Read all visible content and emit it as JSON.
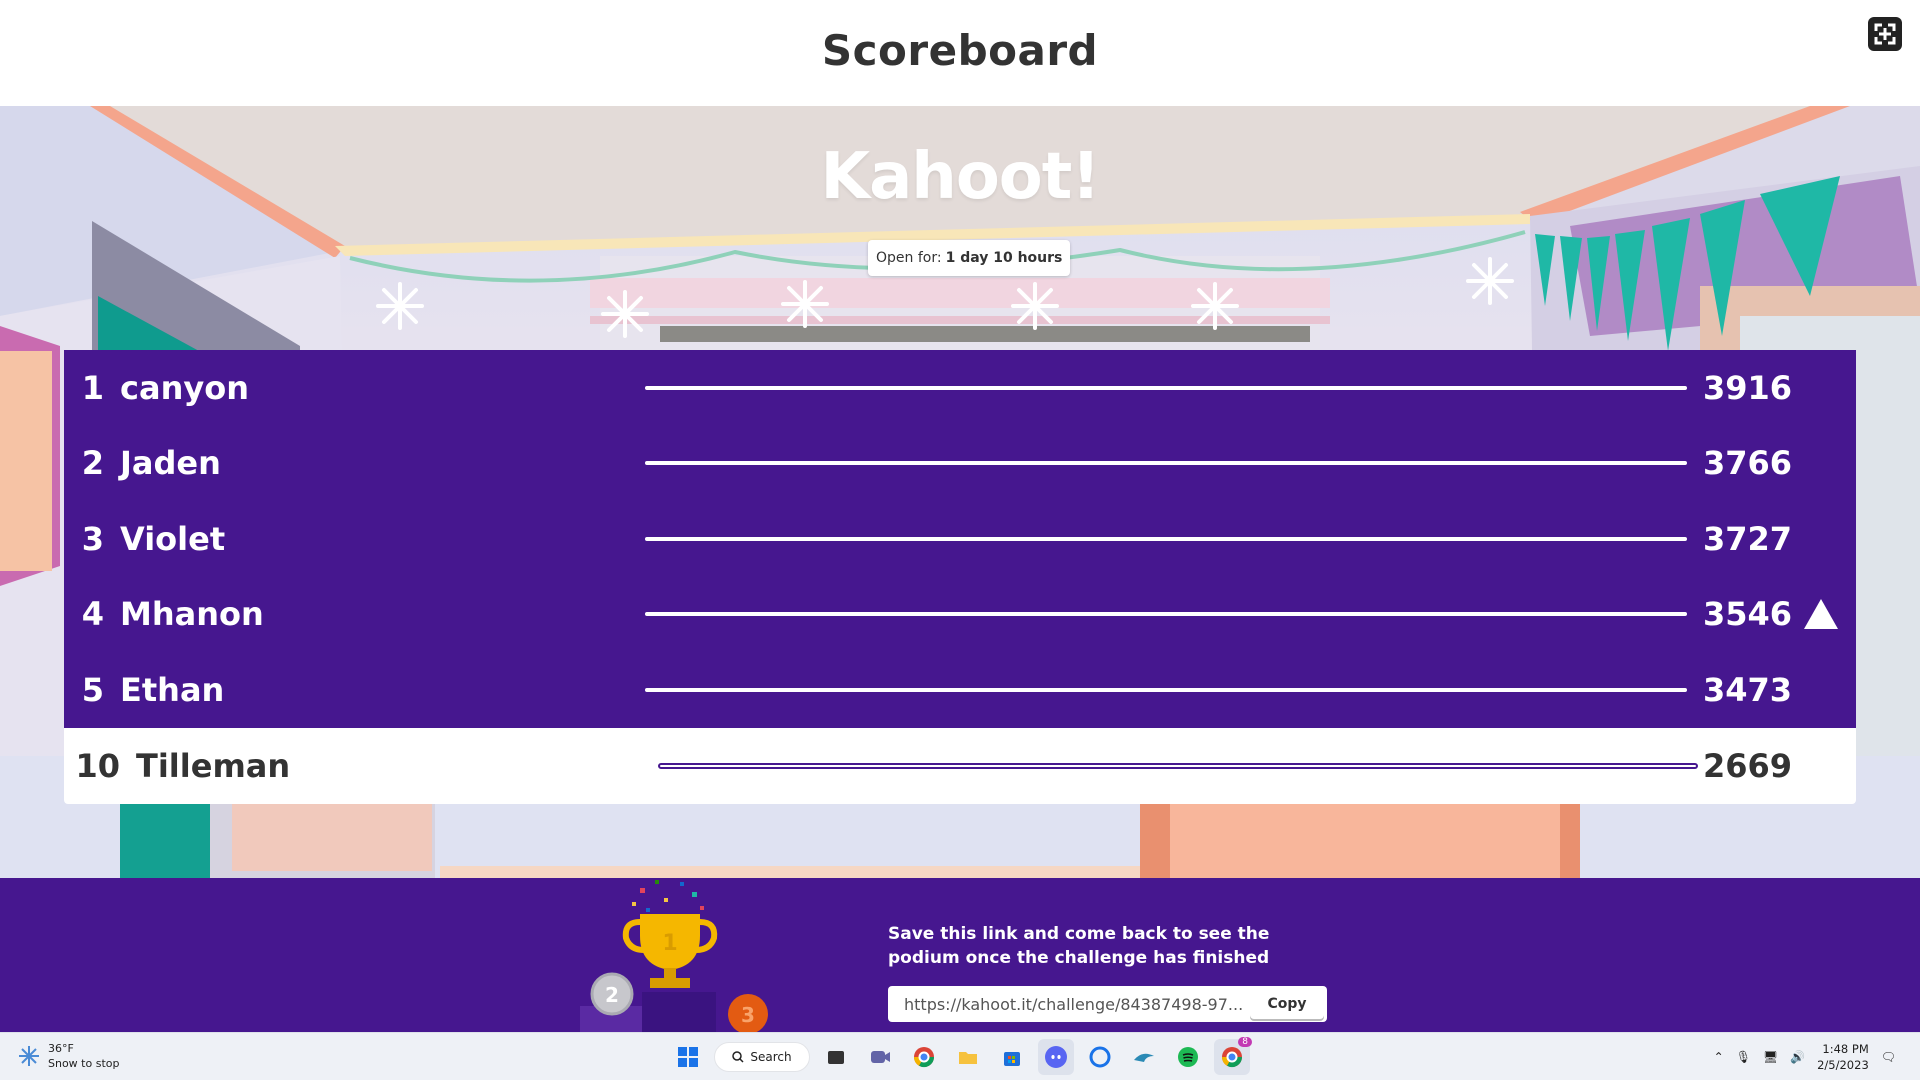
{
  "header": {
    "title": "Scoreboard"
  },
  "logo": {
    "text": "Kahoot!"
  },
  "open_for": {
    "label": "Open for:",
    "value": "1 day 10 hours"
  },
  "scoreboard": {
    "rows": [
      {
        "rank": "1",
        "name": "canyon",
        "score": "3916"
      },
      {
        "rank": "2",
        "name": "Jaden",
        "score": "3766"
      },
      {
        "rank": "3",
        "name": "Violet",
        "score": "3727"
      },
      {
        "rank": "4",
        "name": "Mhanon",
        "score": "3546",
        "trend": "up"
      },
      {
        "rank": "5",
        "name": "Ethan",
        "score": "3473"
      }
    ],
    "current_player": {
      "rank": "10",
      "name": "Tilleman",
      "score": "2669"
    }
  },
  "footer": {
    "save_text": "Save this link and come back to see the podium once the challenge has finished",
    "link": "https://kahoot.it/challenge/84387498-97...",
    "copy_label": "Copy"
  },
  "taskbar": {
    "weather_temp": "36°F",
    "weather_desc": "Snow to stop",
    "search_label": "Search",
    "chrome_badge": "8",
    "time": "1:48 PM",
    "date": "2/5/2023"
  },
  "colors": {
    "brand_purple": "#46178f",
    "accent_teal": "#1fb8a6"
  }
}
